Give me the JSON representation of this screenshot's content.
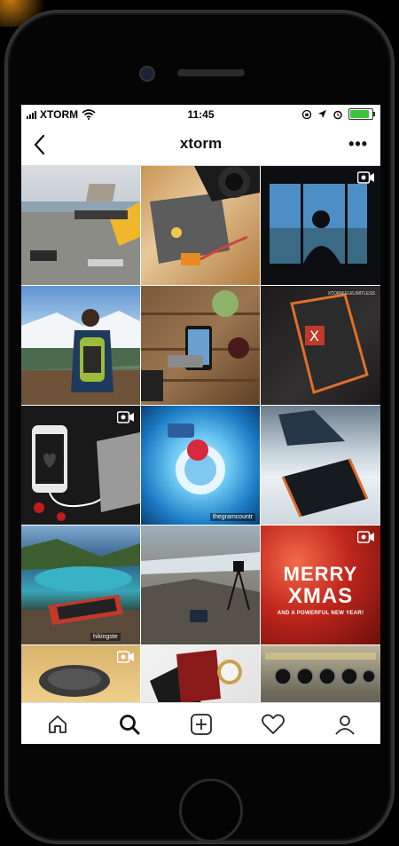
{
  "status_bar": {
    "carrier": "XTORM",
    "time": "11:45",
    "battery_level": 0.95
  },
  "header": {
    "title": "xtorm",
    "back_icon": "chevron-left-icon",
    "more_label": "•••"
  },
  "grid": {
    "tiles": [
      {
        "subject": "laptop-lakeside",
        "video": false
      },
      {
        "subject": "camera-powerbank",
        "video": false
      },
      {
        "subject": "window-silhouette",
        "video": true
      },
      {
        "subject": "hiker-backpack",
        "video": false
      },
      {
        "subject": "phone-on-table",
        "video": false
      },
      {
        "subject": "rugged-powerbank",
        "video": false,
        "tag": "XTORM.EU/LIMITLESS"
      },
      {
        "subject": "iphone-charging",
        "video": true
      },
      {
        "subject": "tiny-planet",
        "video": false,
        "credit": "thegramcountr"
      },
      {
        "subject": "powerbank-snow",
        "video": false
      },
      {
        "subject": "lake-powerbank",
        "video": false,
        "credit": "hikingste"
      },
      {
        "subject": "rocks-tripod",
        "video": false
      },
      {
        "subject": "merry-xmas",
        "video": true,
        "line1": "MERRY",
        "line2": "XMAS",
        "line3": "AND A POWERFUL NEW YEAR!"
      },
      {
        "subject": "wireless-charger",
        "video": true
      },
      {
        "subject": "passport-watch",
        "video": false
      },
      {
        "subject": "cockpit-panel",
        "video": false
      }
    ]
  },
  "tab_bar": {
    "items": [
      "home-icon",
      "search-icon",
      "add-post-icon",
      "heart-icon",
      "profile-icon"
    ],
    "active": "search-icon"
  },
  "colors": {
    "battery_green": "#3ec23b",
    "text": "#111111",
    "divider": "#dddddd"
  }
}
